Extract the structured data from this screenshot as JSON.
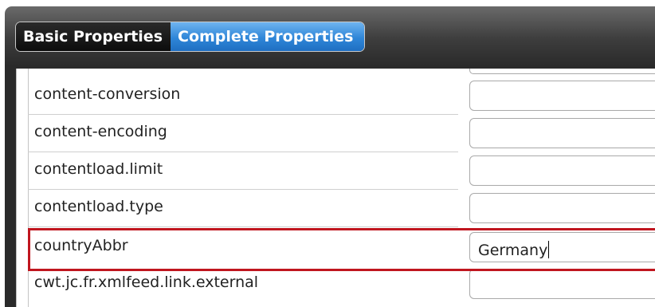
{
  "tabs": [
    {
      "label": "Basic Properties",
      "active": false
    },
    {
      "label": "Complete Properties",
      "active": true
    }
  ],
  "properties": [
    {
      "name": "content-conversion",
      "value": ""
    },
    {
      "name": "content-encoding",
      "value": ""
    },
    {
      "name": "contentload.limit",
      "value": ""
    },
    {
      "name": "contentload.type",
      "value": ""
    },
    {
      "name": "countryAbbr",
      "value": "Germany",
      "highlighted": true
    },
    {
      "name": "cwt.jc.fr.xmlfeed.link.external",
      "value": ""
    }
  ],
  "colors": {
    "active_tab": "#2f86d8",
    "highlight_border": "#c0161f"
  }
}
